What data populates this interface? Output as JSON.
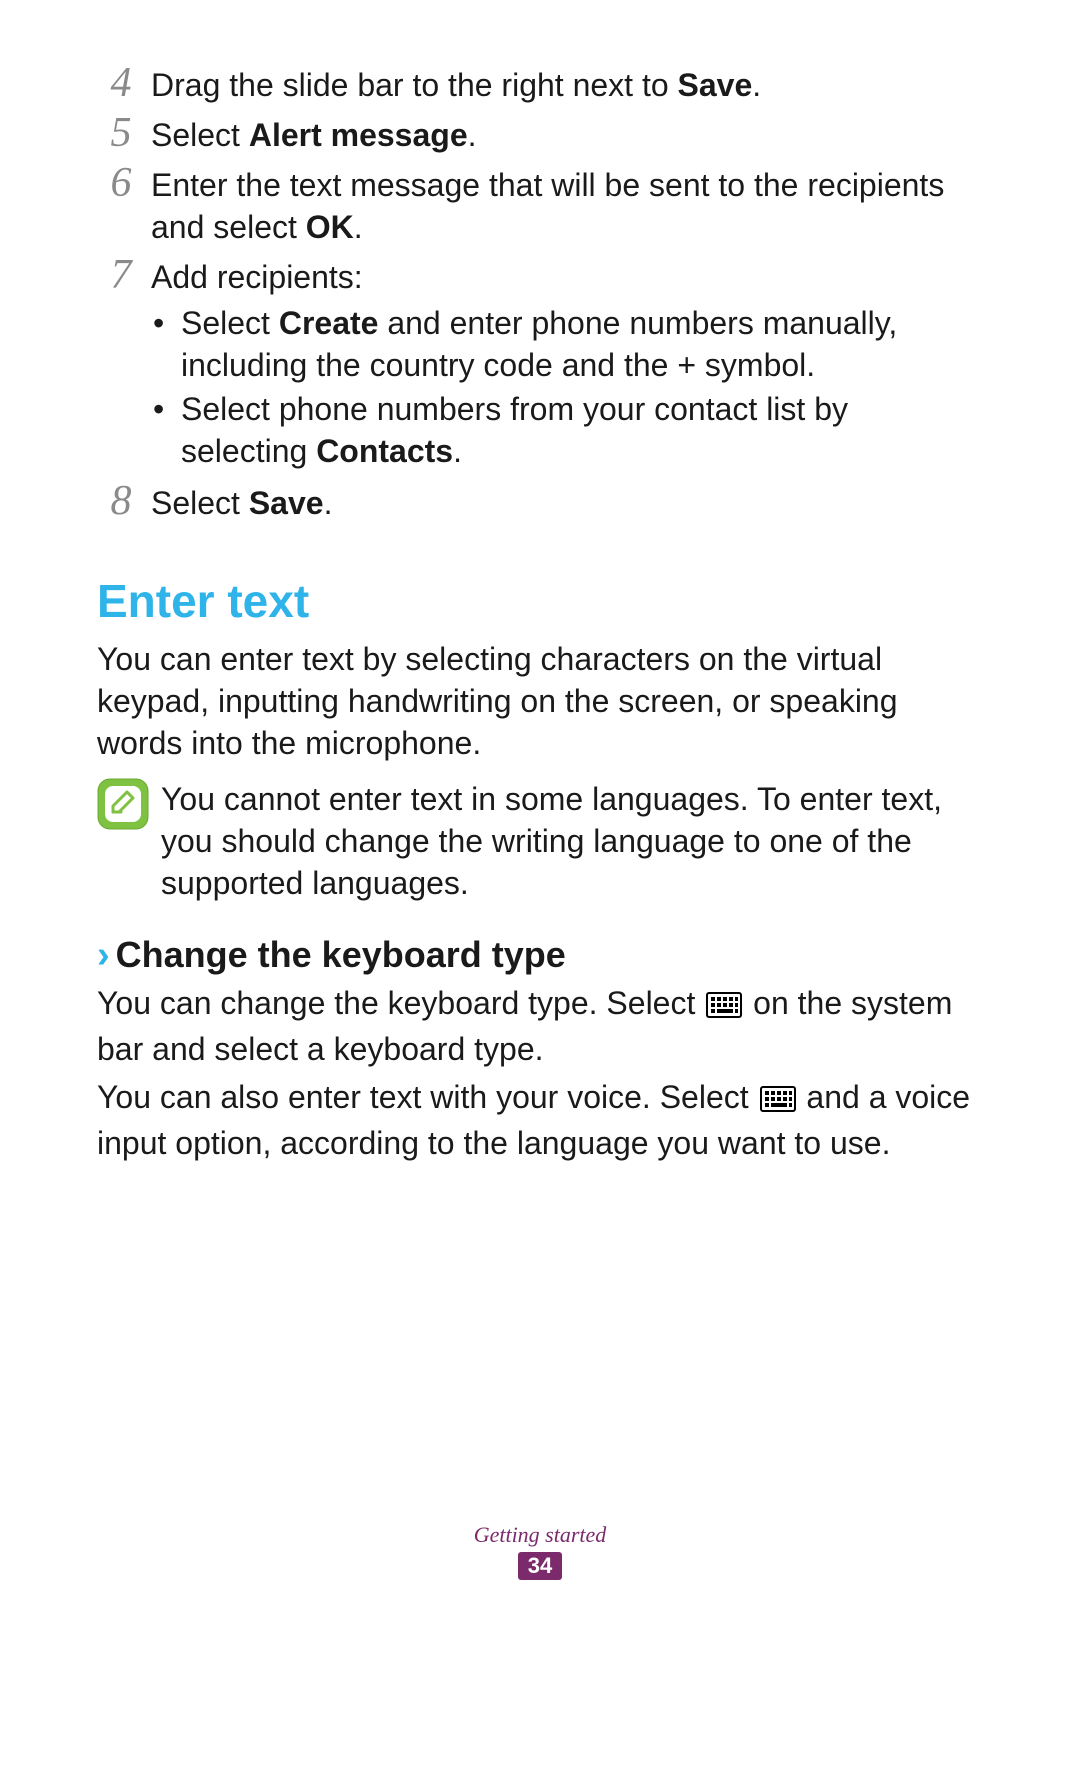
{
  "steps": {
    "s4": {
      "num": "4",
      "pre": "Drag the slide bar to the right next to ",
      "bold": "Save",
      "post": "."
    },
    "s5": {
      "num": "5",
      "pre": "Select ",
      "bold": "Alert message",
      "post": "."
    },
    "s6": {
      "num": "6",
      "pre": "Enter the text message that will be sent to the recipients and select ",
      "bold": "OK",
      "post": "."
    },
    "s7": {
      "num": "7",
      "intro": "Add recipients:",
      "b1": {
        "pre": "Select ",
        "bold": "Create",
        "post": " and enter phone numbers manually, including the country code and the + symbol."
      },
      "b2": {
        "pre": "Select phone numbers from your contact list by selecting ",
        "bold": "Contacts",
        "post": "."
      }
    },
    "s8": {
      "num": "8",
      "pre": "Select ",
      "bold": "Save",
      "post": "."
    }
  },
  "section": {
    "title": "Enter text",
    "intro": "You can enter text by selecting characters on the virtual keypad, inputting handwriting on the screen, or speaking words into the microphone.",
    "note": "You cannot enter text in some languages. To enter text, you should change the writing language to one of the supported languages."
  },
  "sub": {
    "chevron": "›",
    "title": "Change the keyboard type",
    "p1a": "You can change the keyboard type. Select ",
    "p1b": " on the system bar and select a keyboard type.",
    "p2a": "You can also enter text with your voice. Select ",
    "p2b": " and a voice input option, according to the language you want to use."
  },
  "footer": {
    "section": "Getting started",
    "page": "34"
  }
}
